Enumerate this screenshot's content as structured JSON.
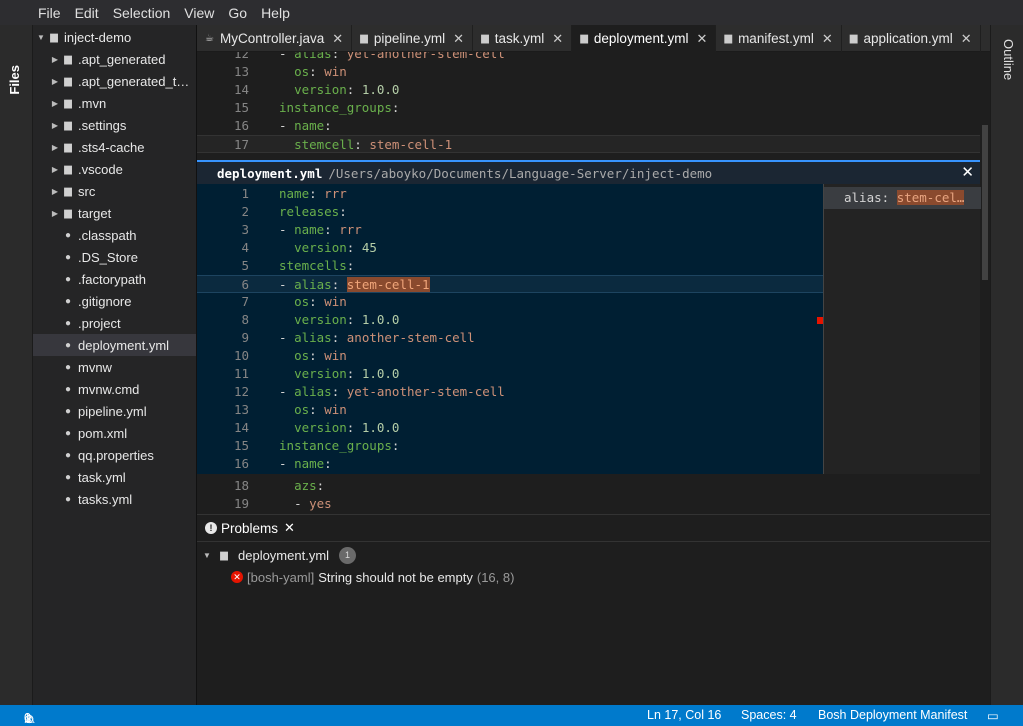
{
  "menu": [
    "File",
    "Edit",
    "Selection",
    "View",
    "Go",
    "Help"
  ],
  "left_panel_label": "Files",
  "right_panel_label": "Outline",
  "explorer": {
    "root": "inject-demo",
    "items": [
      {
        "label": ".apt_generated",
        "type": "folder"
      },
      {
        "label": ".apt_generated_t…",
        "type": "folder"
      },
      {
        "label": ".mvn",
        "type": "folder"
      },
      {
        "label": ".settings",
        "type": "folder"
      },
      {
        "label": ".sts4-cache",
        "type": "folder"
      },
      {
        "label": ".vscode",
        "type": "folder"
      },
      {
        "label": "src",
        "type": "folder"
      },
      {
        "label": "target",
        "type": "folder"
      },
      {
        "label": ".classpath",
        "type": "file"
      },
      {
        "label": ".DS_Store",
        "type": "file"
      },
      {
        "label": ".factorypath",
        "type": "file"
      },
      {
        "label": ".gitignore",
        "type": "file"
      },
      {
        "label": ".project",
        "type": "file"
      },
      {
        "label": "deployment.yml",
        "type": "file",
        "selected": true
      },
      {
        "label": "mvnw",
        "type": "file"
      },
      {
        "label": "mvnw.cmd",
        "type": "file"
      },
      {
        "label": "pipeline.yml",
        "type": "file"
      },
      {
        "label": "pom.xml",
        "type": "file"
      },
      {
        "label": "qq.properties",
        "type": "file"
      },
      {
        "label": "task.yml",
        "type": "file"
      },
      {
        "label": "tasks.yml",
        "type": "file"
      }
    ]
  },
  "tabs": [
    {
      "label": "MyController.java",
      "icon": "java-file-icon",
      "active": false
    },
    {
      "label": "pipeline.yml",
      "icon": "file-icon",
      "active": false
    },
    {
      "label": "task.yml",
      "icon": "file-icon",
      "active": false
    },
    {
      "label": "deployment.yml",
      "icon": "file-icon",
      "active": true
    },
    {
      "label": "manifest.yml",
      "icon": "file-icon",
      "active": false
    },
    {
      "label": "application.yml",
      "icon": "file-icon",
      "active": false
    }
  ],
  "editor_top_lines": [
    {
      "n": "12",
      "text": "- alias: yet-another-stem-cell"
    },
    {
      "n": "13",
      "text": "  os: win"
    },
    {
      "n": "14",
      "text": "  version: 1.0.0"
    },
    {
      "n": "15",
      "text": "instance_groups:"
    },
    {
      "n": "16",
      "text": "- name:"
    },
    {
      "n": "17",
      "text": "  stemcell: stem-cell-1"
    }
  ],
  "peek": {
    "file": "deployment.yml",
    "path": "/Users/aboyko/Documents/Language-Server/inject-demo",
    "reference": "alias: stem-cel…",
    "lines": [
      {
        "n": "1",
        "text": "name: rrr"
      },
      {
        "n": "2",
        "text": "releases:"
      },
      {
        "n": "3",
        "text": "- name: rrr"
      },
      {
        "n": "4",
        "text": "  version: 45"
      },
      {
        "n": "5",
        "text": "stemcells:"
      },
      {
        "n": "6",
        "text": "- alias: stem-cell-1"
      },
      {
        "n": "7",
        "text": "  os: win"
      },
      {
        "n": "8",
        "text": "  version: 1.0.0"
      },
      {
        "n": "9",
        "text": "- alias: another-stem-cell"
      },
      {
        "n": "10",
        "text": "  os: win"
      },
      {
        "n": "11",
        "text": "  version: 1.0.0"
      },
      {
        "n": "12",
        "text": "- alias: yet-another-stem-cell"
      },
      {
        "n": "13",
        "text": "  os: win"
      },
      {
        "n": "14",
        "text": "  version: 1.0.0"
      },
      {
        "n": "15",
        "text": "instance_groups:"
      },
      {
        "n": "16",
        "text": "- name:"
      }
    ]
  },
  "editor_bottom_lines": [
    {
      "n": "18",
      "text": "  azs:"
    },
    {
      "n": "19",
      "text": "  - yes"
    }
  ],
  "problems": {
    "tab_label": "Problems",
    "file": "deployment.yml",
    "count": "1",
    "source": "[bosh-yaml]",
    "message": "String should not be empty",
    "location": "(16, 8)"
  },
  "status": {
    "errors": "1",
    "warnings": "0",
    "position": "Ln 17, Col 16",
    "spaces": "Spaces: 4",
    "language": "Bosh Deployment Manifest"
  },
  "colors": {
    "accent": "#007acc",
    "error": "#e51400",
    "peek_border": "#3794ff"
  }
}
